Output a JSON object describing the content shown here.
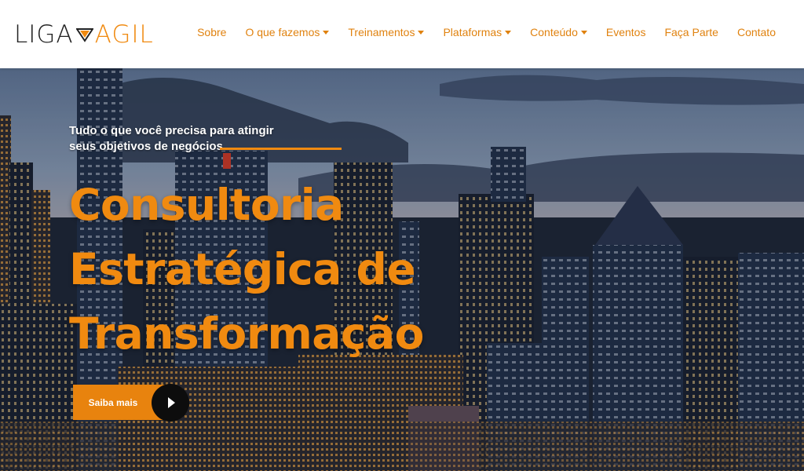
{
  "brand": {
    "liga": "LIGA",
    "agil": "AGIL",
    "accent_color": "#f08a10"
  },
  "nav": {
    "items": [
      {
        "label": "Sobre",
        "dropdown": false
      },
      {
        "label": "O que fazemos",
        "dropdown": true
      },
      {
        "label": "Treinamentos",
        "dropdown": true
      },
      {
        "label": "Plataformas",
        "dropdown": true
      },
      {
        "label": "Conteúdo",
        "dropdown": true
      },
      {
        "label": "Eventos",
        "dropdown": false
      },
      {
        "label": "Faça Parte",
        "dropdown": false
      },
      {
        "label": "Contato",
        "dropdown": false
      }
    ]
  },
  "hero": {
    "tagline_line1": "Tudo o que você precisa para atingir",
    "tagline_line2": "seus objetivos de negócios",
    "headline_line1": "Consultoria",
    "headline_line2": "Estratégica de",
    "headline_line3": "Transformação",
    "cta_label": "Saiba mais",
    "play_icon": "play-icon",
    "background": "night-city-skyline"
  }
}
